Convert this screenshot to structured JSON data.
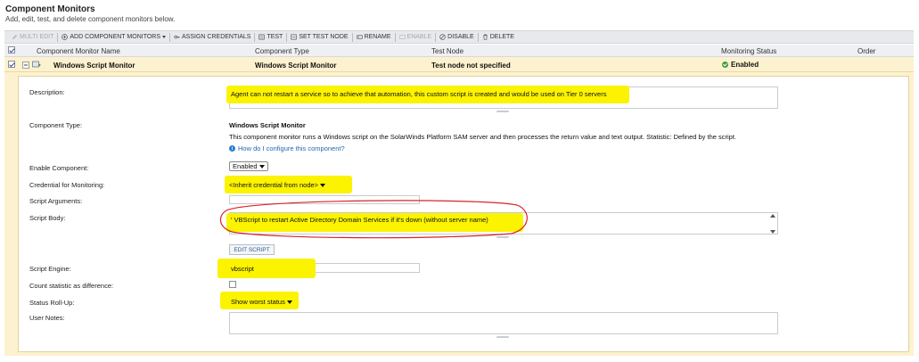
{
  "page": {
    "title": "Component Monitors",
    "subtitle": "Add, edit, test, and delete component monitors below."
  },
  "toolbar": {
    "multi_edit": "Multi Edit",
    "add_component_monitors": "Add Component Monitors",
    "assign_credentials": "Assign Credentials",
    "test": "Test",
    "set_test_node": "Set Test Node",
    "rename": "Rename",
    "enable": "Enable",
    "disable": "Disable",
    "delete": "Delete"
  },
  "table": {
    "headers": {
      "name": "Component Monitor Name",
      "type": "Component Type",
      "test_node": "Test Node",
      "status": "Monitoring Status",
      "order": "Order"
    },
    "row": {
      "name": "Windows Script Monitor",
      "type": "Windows Script Monitor",
      "test_node": "Test node not specified",
      "status": "Enabled"
    }
  },
  "details": {
    "description_label": "Description:",
    "description_value": "Agent can not restart a service so to achieve that automation, this custom script is created and would be used on Tier 0 servers",
    "component_type_label": "Component Type:",
    "component_type_value": "Windows Script Monitor",
    "component_type_desc": "This component monitor runs a Windows script on the SolarWinds Platform SAM server and then processes the return value and text output. Statistic: Defined by the script.",
    "help_link": "How do I configure this component?",
    "enable_label": "Enable Component:",
    "enable_value": "Enabled",
    "credential_label": "Credential for Monitoring:",
    "credential_value": "<Inherit credential from node>",
    "script_args_label": "Script Arguments:",
    "script_body_label": "Script Body:",
    "script_body_value": "' VBScript to restart Active Directory Domain Services if it's down (without server name)",
    "edit_script_button": "Edit Script",
    "script_engine_label": "Script Engine:",
    "script_engine_value": "vbscript",
    "count_stat_label": "Count statistic as difference:",
    "status_rollup_label": "Status Roll-Up:",
    "status_rollup_value": "Show worst status",
    "user_notes_label": "User Notes:"
  },
  "colors": {
    "highlight": "#fbf300",
    "annotation_circle": "#d9232a",
    "selected_row": "#fdf2cf",
    "toolbar_bg": "#e8e9ec",
    "link": "#2567b3"
  }
}
